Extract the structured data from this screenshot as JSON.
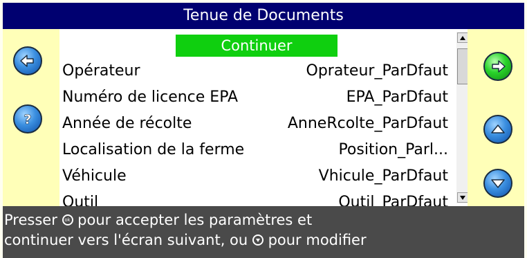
{
  "title": "Tenue de Documents",
  "continue_label": "Continuer",
  "rows": [
    {
      "label": "Opérateur",
      "value": "Oprateur_ParDfaut"
    },
    {
      "label": "Numéro de licence EPA",
      "value": "EPA_ParDfaut"
    },
    {
      "label": "Année de récolte",
      "value": "AnneRcolte_ParDfaut"
    },
    {
      "label": "Localisation de la ferme",
      "value": "Position_Parl..."
    },
    {
      "label": "Véhicule",
      "value": "Vhicule_ParDfaut"
    },
    {
      "label": "Outil",
      "value": "Outil_ParDfaut"
    }
  ],
  "footer": {
    "line1_a": "Presser ",
    "line1_b": " pour accepter les paramètres et",
    "line2_a": "continuer vers l'écran suivant, ou ",
    "line2_b": " pour modifier"
  },
  "icons": {
    "back": "arrow-left-icon",
    "help": "question-mark-icon",
    "next": "arrow-right-icon",
    "up": "arrow-up-icon",
    "down": "arrow-down-icon"
  },
  "colors": {
    "title_bg": "#000070",
    "side_bg": "#ffffb8",
    "continue_bg": "#0fcf0f",
    "footer_bg": "#4a4a4a",
    "blue_button": "#3b8fe0",
    "green_button": "#29d32a"
  }
}
